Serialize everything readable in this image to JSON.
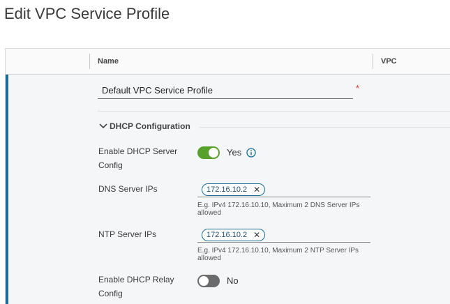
{
  "page": {
    "title": "Edit VPC Service Profile"
  },
  "grid": {
    "columns": [
      {
        "label": "Name"
      },
      {
        "label": "VPC"
      }
    ]
  },
  "form": {
    "name": {
      "value": "Default VPC Service Profile",
      "required_mark": "*"
    },
    "dhcp": {
      "section_label": "DHCP Configuration",
      "enable_server": {
        "label": "Enable DHCP Server Config",
        "state": "on",
        "state_label": "Yes"
      },
      "dns": {
        "label": "DNS Server IPs",
        "chips": [
          "172.16.10.2"
        ],
        "helper": "E.g. IPv4 172.16.10.10, Maximum 2 DNS Server IPs allowed"
      },
      "ntp": {
        "label": "NTP Server IPs",
        "chips": [
          "172.16.10.2"
        ],
        "helper": "E.g. IPv4 172.16.10.10, Maximum 2 NTP Server IPs allowed"
      },
      "enable_relay": {
        "label": "Enable DHCP Relay Config",
        "state": "off",
        "state_label": "No"
      }
    }
  },
  "colors": {
    "accent": "#1b6d96",
    "toggle_on": "#56a02b",
    "toggle_off": "#6b6b6b",
    "required": "#d6362f"
  },
  "icons": {
    "info": "info-icon",
    "chevron": "chevron-down-icon",
    "chip_remove": "close-icon"
  }
}
